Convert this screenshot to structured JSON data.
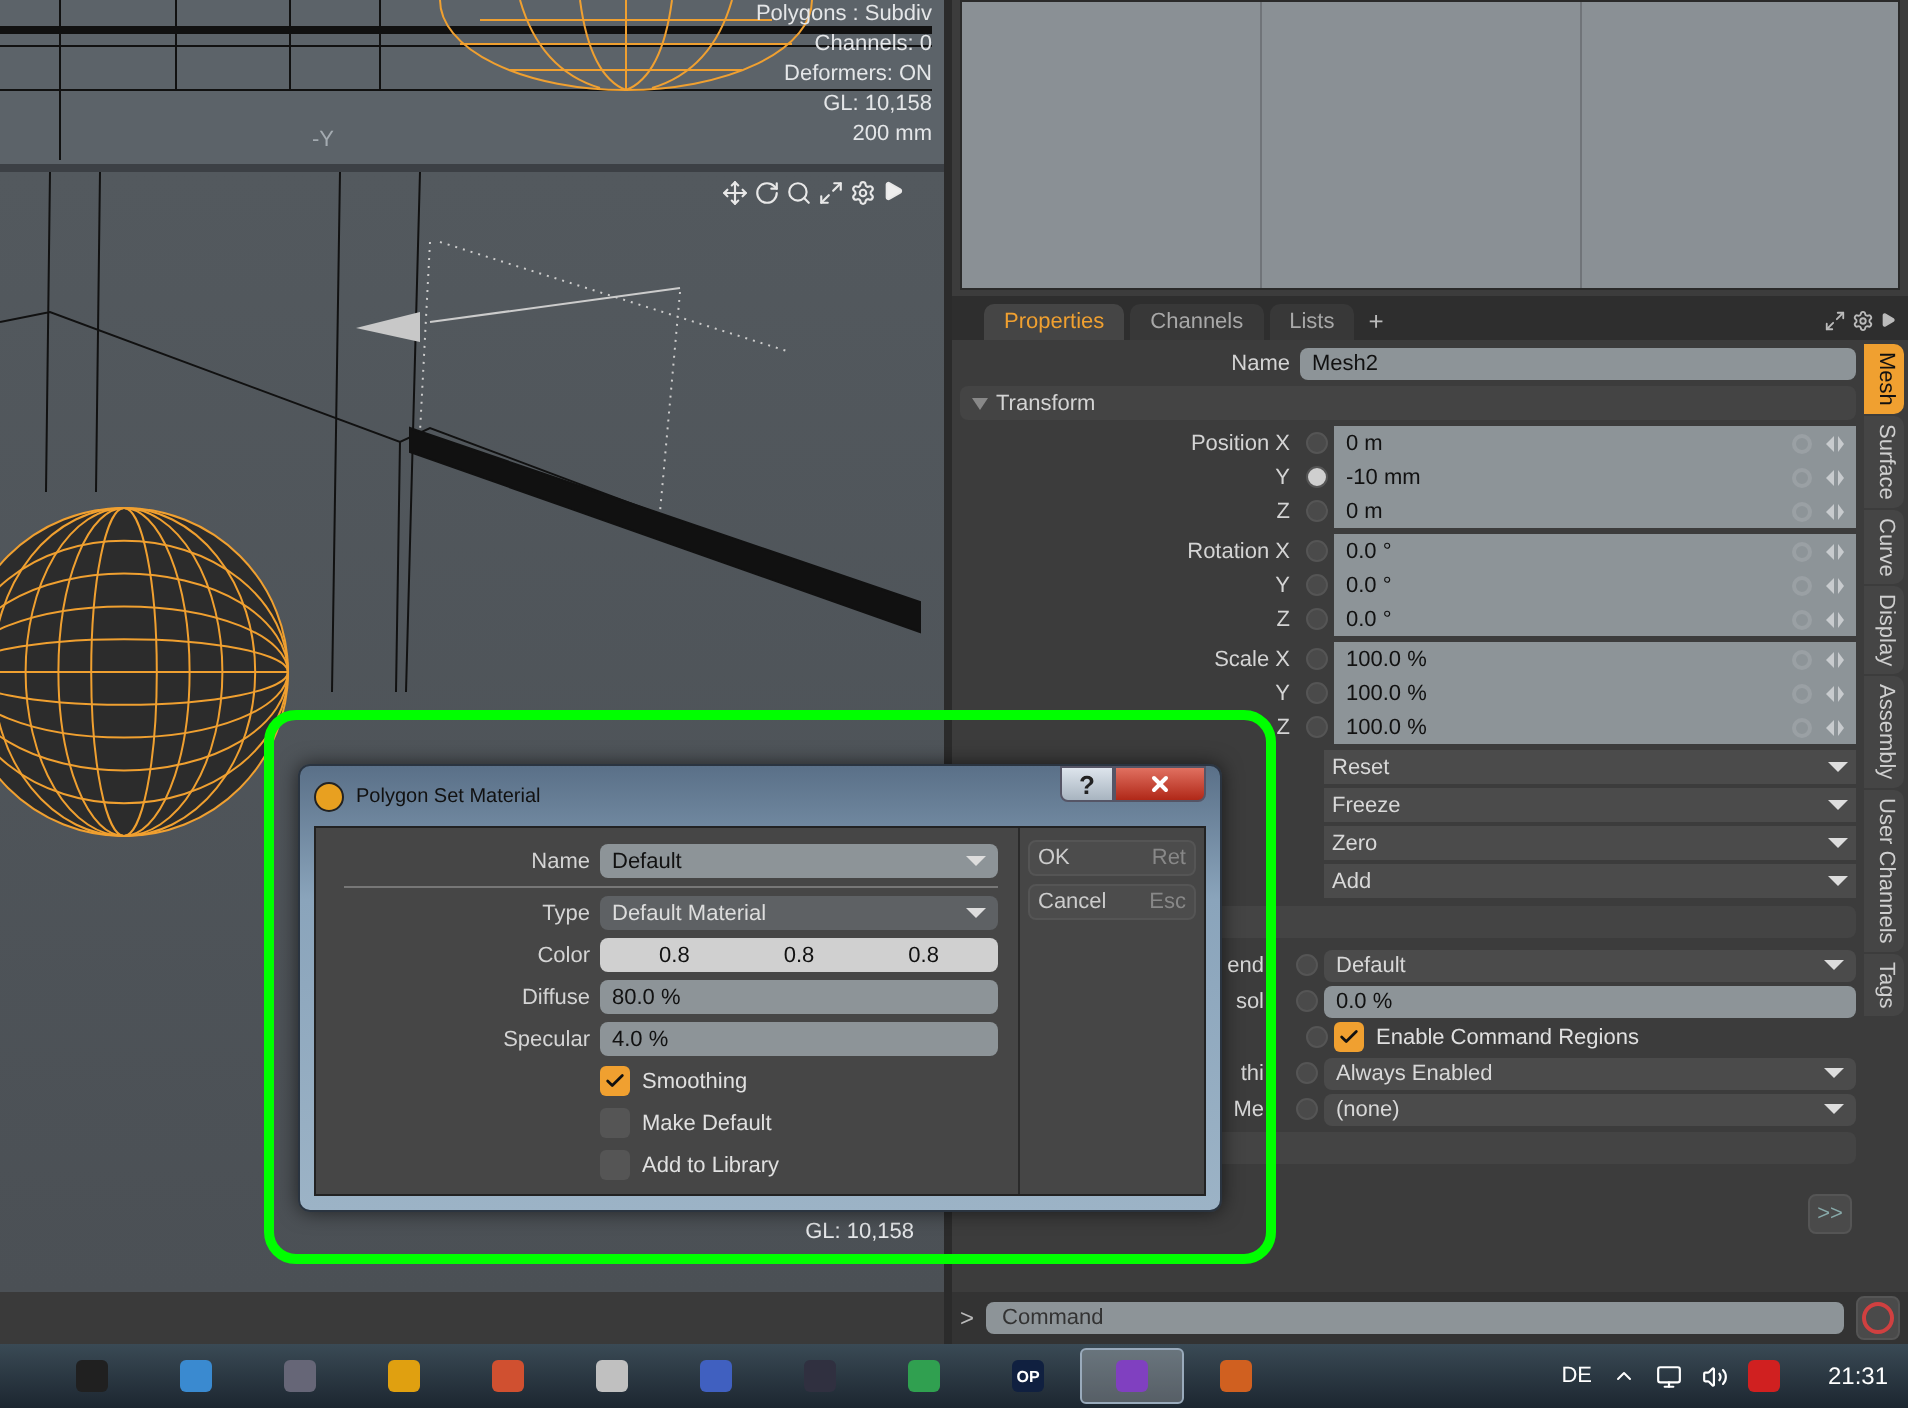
{
  "viewport_top": {
    "stats": [
      "Polygons : Subdiv",
      "Channels: 0",
      "Deformers: ON",
      "GL: 10,158",
      "200 mm"
    ],
    "axis_label": "-Y"
  },
  "viewport": {
    "stats": [
      "GL: 10,158"
    ]
  },
  "properties": {
    "tabs": [
      {
        "label": "Properties",
        "selected": true
      },
      {
        "label": "Channels",
        "selected": false
      },
      {
        "label": "Lists",
        "selected": false
      }
    ],
    "add_tab": "+",
    "name_label": "Name",
    "name_value": "Mesh2",
    "section": {
      "label": "Transform",
      "expanded": true
    },
    "groups": [
      {
        "rows": [
          {
            "label": "Position X",
            "value": "0 m",
            "keyed": false
          },
          {
            "label": "Y",
            "value": "-10 mm",
            "keyed": true
          },
          {
            "label": "Z",
            "value": "0 m",
            "keyed": false
          }
        ]
      },
      {
        "rows": [
          {
            "label": "Rotation X",
            "value": "0.0 °",
            "keyed": false
          },
          {
            "label": "Y",
            "value": "0.0 °",
            "keyed": false
          },
          {
            "label": "Z",
            "value": "0.0 °",
            "keyed": false
          }
        ]
      },
      {
        "rows": [
          {
            "label": "Scale X",
            "value": "100.0 %",
            "keyed": false
          },
          {
            "label": "Y",
            "value": "100.0 %",
            "keyed": false
          },
          {
            "label": "Z",
            "value": "100.0 %",
            "keyed": false
          }
        ]
      }
    ],
    "actions": [
      "Reset",
      "Freeze",
      "Zero",
      "Add"
    ],
    "settings": [
      {
        "kind": "dropdown",
        "label": "end",
        "value": "Default"
      },
      {
        "kind": "slider",
        "label": "sol",
        "value": "0.0 %"
      },
      {
        "kind": "checkbox",
        "value": "Enable Command Regions",
        "checked": true
      },
      {
        "kind": "dropdown",
        "label": "thi",
        "value": "Always Enabled"
      },
      {
        "kind": "dropdown",
        "label": "Me",
        "value": "(none)"
      }
    ],
    "more_button": ">>",
    "side_tabs": [
      {
        "label": "Mesh",
        "selected": true
      },
      {
        "label": "Surface",
        "selected": false
      },
      {
        "label": "Curve",
        "selected": false
      },
      {
        "label": "Display",
        "selected": false
      },
      {
        "label": "Assembly",
        "selected": false
      },
      {
        "label": "User Channels",
        "selected": false
      },
      {
        "label": "Tags",
        "selected": false
      }
    ]
  },
  "command": {
    "prompt": ">",
    "placeholder": "Command"
  },
  "dialog": {
    "title": "Polygon Set Material",
    "help_button": "?",
    "name_label": "Name",
    "name_value": "Default",
    "fields": [
      {
        "kind": "dropdown",
        "label": "Type",
        "value": "Default Material"
      },
      {
        "kind": "color",
        "label": "Color",
        "values": [
          "0.8",
          "0.8",
          "0.8"
        ]
      },
      {
        "kind": "slider",
        "label": "Diffuse",
        "value": "80.0 %"
      },
      {
        "kind": "slider",
        "label": "Specular",
        "value": "4.0 %"
      }
    ],
    "checkboxes": [
      {
        "label": "Smoothing",
        "checked": true
      },
      {
        "label": "Make Default",
        "checked": false
      },
      {
        "label": "Add to Library",
        "checked": false
      }
    ],
    "buttons": [
      {
        "label": "OK",
        "shortcut": "Ret"
      },
      {
        "label": "Cancel",
        "shortcut": "Esc"
      }
    ]
  },
  "taskbar": {
    "apps": [
      {
        "selected": false
      },
      {
        "selected": false
      },
      {
        "selected": false
      },
      {
        "selected": false
      },
      {
        "selected": false
      },
      {
        "selected": false
      },
      {
        "selected": false
      },
      {
        "selected": false
      },
      {
        "selected": false
      },
      {
        "selected": false,
        "label": "OP"
      },
      {
        "selected": true
      },
      {
        "selected": false
      }
    ],
    "language": "DE",
    "time": "21:31"
  }
}
